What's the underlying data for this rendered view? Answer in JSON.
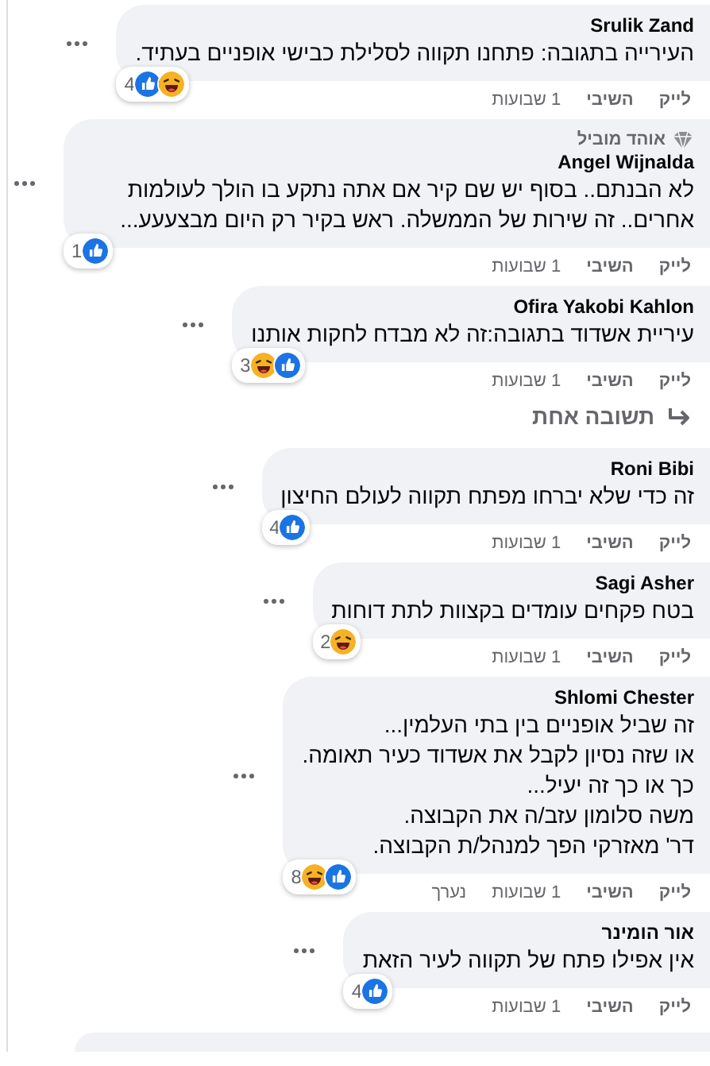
{
  "comments": [
    {
      "kind": "comment",
      "author": "Srulik Zand",
      "lines": [
        "העירייה בתגובה: פתחנו תקווה לסלילת כבישי אופניים בעתיד."
      ],
      "reactions": {
        "count": "4",
        "icons": [
          {
            "kind": "like"
          },
          {
            "kind": "haha"
          }
        ]
      },
      "actions": [
        "לייק",
        "השיבי",
        "1 שבועות"
      ]
    },
    {
      "kind": "comment",
      "badge": "אוהד מוביל",
      "author": "Angel Wijnalda",
      "lines": [
        "לא הבנתם.. בסוף יש שם קיר אם אתה נתקע בו הולך לעולמות אחרים.. זה שירות של הממשלה. ראש בקיר רק היום מבצעעע..."
      ],
      "reactions": {
        "count": "1",
        "icons": [
          {
            "kind": "like"
          }
        ]
      },
      "actions": [
        "לייק",
        "השיבי",
        "1 שבועות"
      ]
    },
    {
      "kind": "comment",
      "author": "Ofira Yakobi Kahlon",
      "lines": [
        "עיריית אשדוד בתגובה:זה לא מבדח לחקות אותנו"
      ],
      "reactions": {
        "count": "3",
        "icons": [
          {
            "kind": "haha"
          },
          {
            "kind": "like"
          }
        ]
      },
      "actions": [
        "לייק",
        "השיבי",
        "1 שבועות"
      ]
    },
    {
      "kind": "replies",
      "label": "תשובה אחת"
    },
    {
      "kind": "comment",
      "author": "Roni Bibi",
      "lines": [
        "זה כדי שלא יברחו מפתח תקווה לעולם החיצון"
      ],
      "reactions": {
        "count": "4",
        "icons": [
          {
            "kind": "like"
          }
        ]
      },
      "actions": [
        "לייק",
        "השיבי",
        "1 שבועות"
      ]
    },
    {
      "kind": "comment",
      "author": "Sagi Asher",
      "lines": [
        "בטח פקחים עומדים בקצוות לתת דוחות"
      ],
      "reactions": {
        "count": "2",
        "icons": [
          {
            "kind": "haha"
          }
        ]
      },
      "actions": [
        "לייק",
        "השיבי",
        "1 שבועות"
      ]
    },
    {
      "kind": "comment",
      "author": "Shlomi Chester",
      "lines": [
        "זה שביל אופניים בין בתי העלמין...",
        "או שזה נסיון לקבל את אשדוד כעיר תאומה.",
        "כך או כך זה יעיל...",
        "משה סלומון עזב/ה את הקבוצה.",
        "דר' מאזרקי הפך למנהל/ת הקבוצה."
      ],
      "reactions": {
        "count": "8",
        "icons": [
          {
            "kind": "haha"
          },
          {
            "kind": "like"
          }
        ]
      },
      "actions": [
        "לייק",
        "השיבי",
        "1 שבועות",
        "נערך"
      ]
    },
    {
      "kind": "comment",
      "author": "אור הומינר",
      "lines": [
        "אין אפילו פתח של תקווה לעיר הזאת"
      ],
      "reactions": {
        "count": "4",
        "icons": [
          {
            "kind": "like"
          }
        ]
      },
      "actions": [
        "לייק",
        "השיבי",
        "1 שבועות"
      ]
    },
    {
      "kind": "partial"
    }
  ]
}
